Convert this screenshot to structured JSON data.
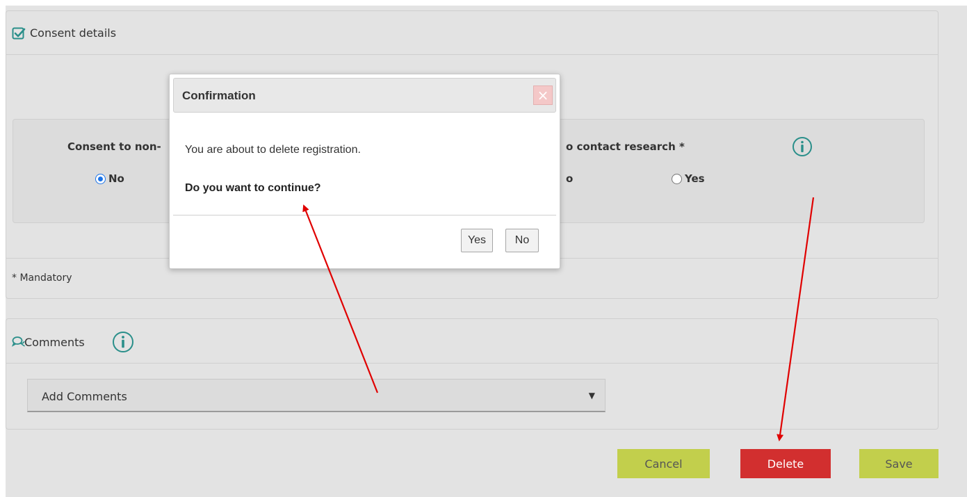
{
  "consent": {
    "title": "Consent details",
    "q1_label": "Consent to non-",
    "q1_option_no": "No",
    "q2_label": "o contact research *",
    "q2_partial": "o",
    "q2_option_yes": "Yes",
    "mandatory": "* Mandatory"
  },
  "comments": {
    "title": "Comments",
    "select_label": "Add Comments"
  },
  "footer": {
    "cancel": "Cancel",
    "delete": "Delete",
    "save": "Save"
  },
  "dialog": {
    "title": "Confirmation",
    "message": "You are about to delete registration.",
    "question": "Do you want to continue?",
    "yes": "Yes",
    "no": "No"
  },
  "icons": {
    "check": "check-square-icon",
    "info": "info-circle-icon",
    "chat": "comments-icon",
    "close": "close-icon",
    "dropdown": "triangle-down-icon"
  },
  "colors": {
    "accent": "#2a8f8a",
    "delete": "#d22f2f",
    "primary_button": "#c2cf4c",
    "arrow": "#e00000"
  }
}
